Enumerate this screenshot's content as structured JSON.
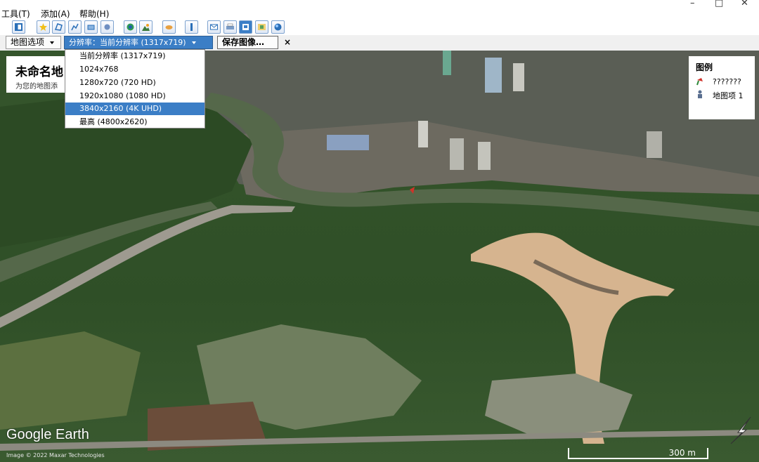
{
  "menubar": {
    "menus": [
      "工具(T)",
      "添加(A)",
      "帮助(H)"
    ],
    "window_controls": [
      "–",
      "□",
      "✕"
    ]
  },
  "toolbar": {
    "icons": [
      "sidebar-toggle-icon",
      "add-placemark-icon",
      "add-polygon-icon",
      "add-path-icon",
      "add-overlay-icon",
      "record-tour-icon",
      "historical-imagery-icon",
      "sunlight-icon",
      "planets-icon",
      "ruler-icon",
      "email-icon",
      "print-icon",
      "save-image-icon",
      "view-in-maps-icon",
      "google-earth-icon"
    ]
  },
  "save_bar": {
    "map_options_label": "地图选项",
    "resolution_label": "分辨率：当前分辨率 (1317x719)",
    "save_button_label": "保存图像…",
    "close_label": "×"
  },
  "resolution_dropdown": {
    "options": [
      "当前分辨率 (1317x719)",
      "1024x768",
      "1280x720 (720 HD)",
      "1920x1080 (1080 HD)",
      "3840x2160 (4K UHD)",
      "最高 (4800x2620)"
    ],
    "selected_index": 4
  },
  "title_box": {
    "title": "未命名地",
    "subtitle": "为您的地图添"
  },
  "legend": {
    "title": "图例",
    "items": [
      {
        "label": "???????",
        "icon": "placemark-pushpin-icon"
      },
      {
        "label": "地图项 1",
        "icon": "tour-person-icon"
      }
    ]
  },
  "map": {
    "logo_text": "Google Earth",
    "credit": "Image © 2022 Maxar Technologies",
    "scale_label": "300 m"
  },
  "colors": {
    "accent": "#3b7ec6",
    "river": "#55684a",
    "forest": "#2e4a26",
    "quarry": "#d6b48f"
  }
}
